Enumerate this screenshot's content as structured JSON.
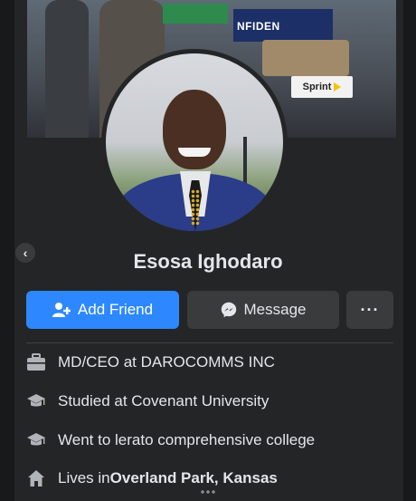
{
  "cover": {
    "banner_text": "NFIDEN",
    "sign_text": "Sprint"
  },
  "profile": {
    "name": "Esosa Ighodaro"
  },
  "actions": {
    "add_friend_label": "Add Friend",
    "message_label": "Message",
    "more_label": "···"
  },
  "back_button": {
    "label": "‹"
  },
  "details": [
    {
      "prefix": "MD/CEO at DAROCOMMS INC",
      "strong": "",
      "suffix": "",
      "icon": "briefcase-icon"
    },
    {
      "prefix": "Studied at Covenant University",
      "strong": "",
      "suffix": "",
      "icon": "graduation-cap-icon"
    },
    {
      "prefix": "Went to lerato comprehensive college",
      "strong": "",
      "suffix": "",
      "icon": "graduation-cap-icon"
    },
    {
      "prefix": "Lives in ",
      "strong": "Overland Park, Kansas",
      "suffix": "",
      "icon": "home-icon"
    }
  ],
  "colors": {
    "primary": "#2d88ff",
    "surface": "#242526",
    "button_secondary": "#3a3b3c",
    "text": "#e4e6eb"
  }
}
